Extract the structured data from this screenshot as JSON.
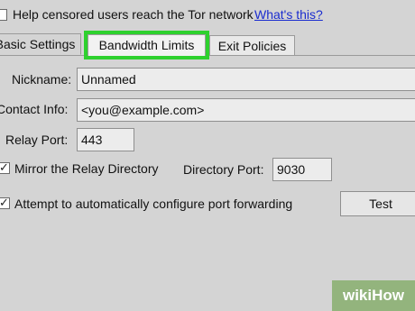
{
  "bridge": {
    "checkbox_checked": false,
    "label": "Help censored users reach the Tor network",
    "help_link": "What's this?"
  },
  "tabs": [
    {
      "label": "Basic Settings",
      "state": "active"
    },
    {
      "label": "Bandwidth Limits",
      "state": "highlighted"
    },
    {
      "label": "Exit Policies",
      "state": "inactive"
    }
  ],
  "form": {
    "nickname_label": "Nickname:",
    "nickname_value": "Unnamed",
    "contact_label": "Contact Info:",
    "contact_value": "<you@example.com>",
    "relay_port_label": "Relay Port:",
    "relay_port_value": "443",
    "mirror_checked": true,
    "mirror_label": "Mirror the Relay Directory",
    "directory_port_label": "Directory Port:",
    "directory_port_value": "9030",
    "upnp_checked": true,
    "upnp_label": "Attempt to automatically configure port forwarding",
    "test_button": "Test"
  },
  "watermark": {
    "wiki": "wiki",
    "how": "How"
  },
  "colors": {
    "highlight": "#2ed12e",
    "link": "#1a2ccf",
    "background": "#d4d4d4",
    "watermark": "#93b47d"
  }
}
